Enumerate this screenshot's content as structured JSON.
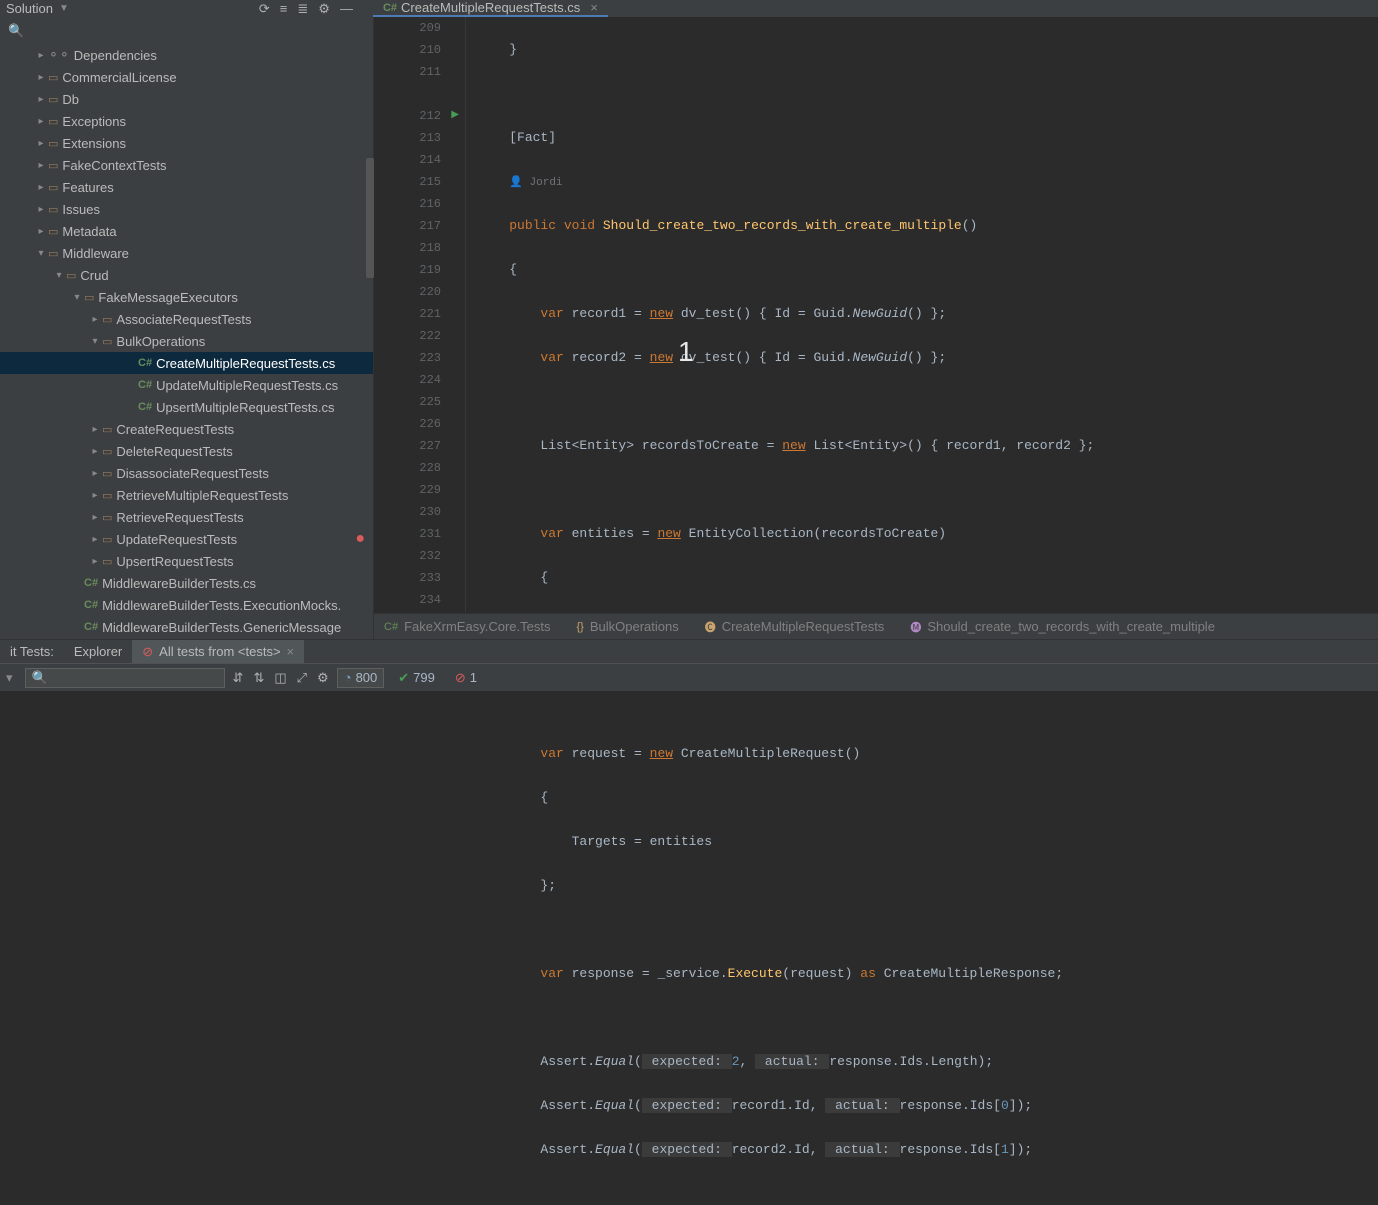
{
  "top": {
    "solution_label": "Solution",
    "tab_label": "CreateMultipleRequestTests.cs"
  },
  "tree": {
    "items": [
      {
        "label": "Dependencies",
        "indent": 0,
        "kind": "dep",
        "chev": "r"
      },
      {
        "label": "CommercialLicense",
        "indent": 0,
        "kind": "folder",
        "chev": "r"
      },
      {
        "label": "Db",
        "indent": 0,
        "kind": "folder",
        "chev": "r"
      },
      {
        "label": "Exceptions",
        "indent": 0,
        "kind": "folder",
        "chev": "r"
      },
      {
        "label": "Extensions",
        "indent": 0,
        "kind": "folder",
        "chev": "r"
      },
      {
        "label": "FakeContextTests",
        "indent": 0,
        "kind": "folder",
        "chev": "r"
      },
      {
        "label": "Features",
        "indent": 0,
        "kind": "folder",
        "chev": "r"
      },
      {
        "label": "Issues",
        "indent": 0,
        "kind": "folder",
        "chev": "r"
      },
      {
        "label": "Metadata",
        "indent": 0,
        "kind": "folder",
        "chev": "r"
      },
      {
        "label": "Middleware",
        "indent": 0,
        "kind": "folder",
        "chev": "d"
      },
      {
        "label": "Crud",
        "indent": 1,
        "kind": "folder",
        "chev": "d"
      },
      {
        "label": "FakeMessageExecutors",
        "indent": 2,
        "kind": "folder",
        "chev": "d"
      },
      {
        "label": "AssociateRequestTests",
        "indent": 3,
        "kind": "folder",
        "chev": "r"
      },
      {
        "label": "BulkOperations",
        "indent": 3,
        "kind": "folder",
        "chev": "d"
      },
      {
        "label": "CreateMultipleRequestTests.cs",
        "indent": 4,
        "kind": "cs",
        "chev": "",
        "selected": true
      },
      {
        "label": "UpdateMultipleRequestTests.cs",
        "indent": 4,
        "kind": "cs",
        "chev": ""
      },
      {
        "label": "UpsertMultipleRequestTests.cs",
        "indent": 4,
        "kind": "cs",
        "chev": ""
      },
      {
        "label": "CreateRequestTests",
        "indent": 3,
        "kind": "folder",
        "chev": "r"
      },
      {
        "label": "DeleteRequestTests",
        "indent": 3,
        "kind": "folder",
        "chev": "r"
      },
      {
        "label": "DisassociateRequestTests",
        "indent": 3,
        "kind": "folder",
        "chev": "r"
      },
      {
        "label": "RetrieveMultipleRequestTests",
        "indent": 3,
        "kind": "folder",
        "chev": "r"
      },
      {
        "label": "RetrieveRequestTests",
        "indent": 3,
        "kind": "folder",
        "chev": "r"
      },
      {
        "label": "UpdateRequestTests",
        "indent": 3,
        "kind": "folder",
        "chev": "r",
        "dot": true
      },
      {
        "label": "UpsertRequestTests",
        "indent": 3,
        "kind": "folder",
        "chev": "r"
      },
      {
        "label": "MiddlewareBuilderTests.cs",
        "indent": 2,
        "kind": "cs",
        "chev": ""
      },
      {
        "label": "MiddlewareBuilderTests.ExecutionMocks.",
        "indent": 2,
        "kind": "cs",
        "chev": ""
      },
      {
        "label": "MiddlewareBuilderTests.GenericMessage",
        "indent": 2,
        "kind": "cs",
        "chev": ""
      }
    ]
  },
  "gutter": [
    "209",
    "210",
    "211",
    "",
    "212",
    "213",
    "214",
    "215",
    "216",
    "217",
    "218",
    "219",
    "220",
    "221",
    "222",
    "223",
    "224",
    "225",
    "226",
    "227",
    "228",
    "229",
    "230",
    "231",
    "232",
    "233",
    "234"
  ],
  "gutter_play_index": 4,
  "code_author": "Jordi",
  "breadcrumb": {
    "project": "FakeXrmEasy.Core.Tests",
    "folder": "BulkOperations",
    "class": "CreateMultipleRequestTests",
    "method": "Should_create_two_records_with_create_multiple"
  },
  "bottom_tabs": {
    "left_label": "it Tests:",
    "explorer": "Explorer",
    "tests_label": "All tests from <tests>"
  },
  "status": {
    "total": "800",
    "pass": "799",
    "fail": "1",
    "search_placeholder": ""
  },
  "overlay_numbers": {
    "one": "1"
  }
}
